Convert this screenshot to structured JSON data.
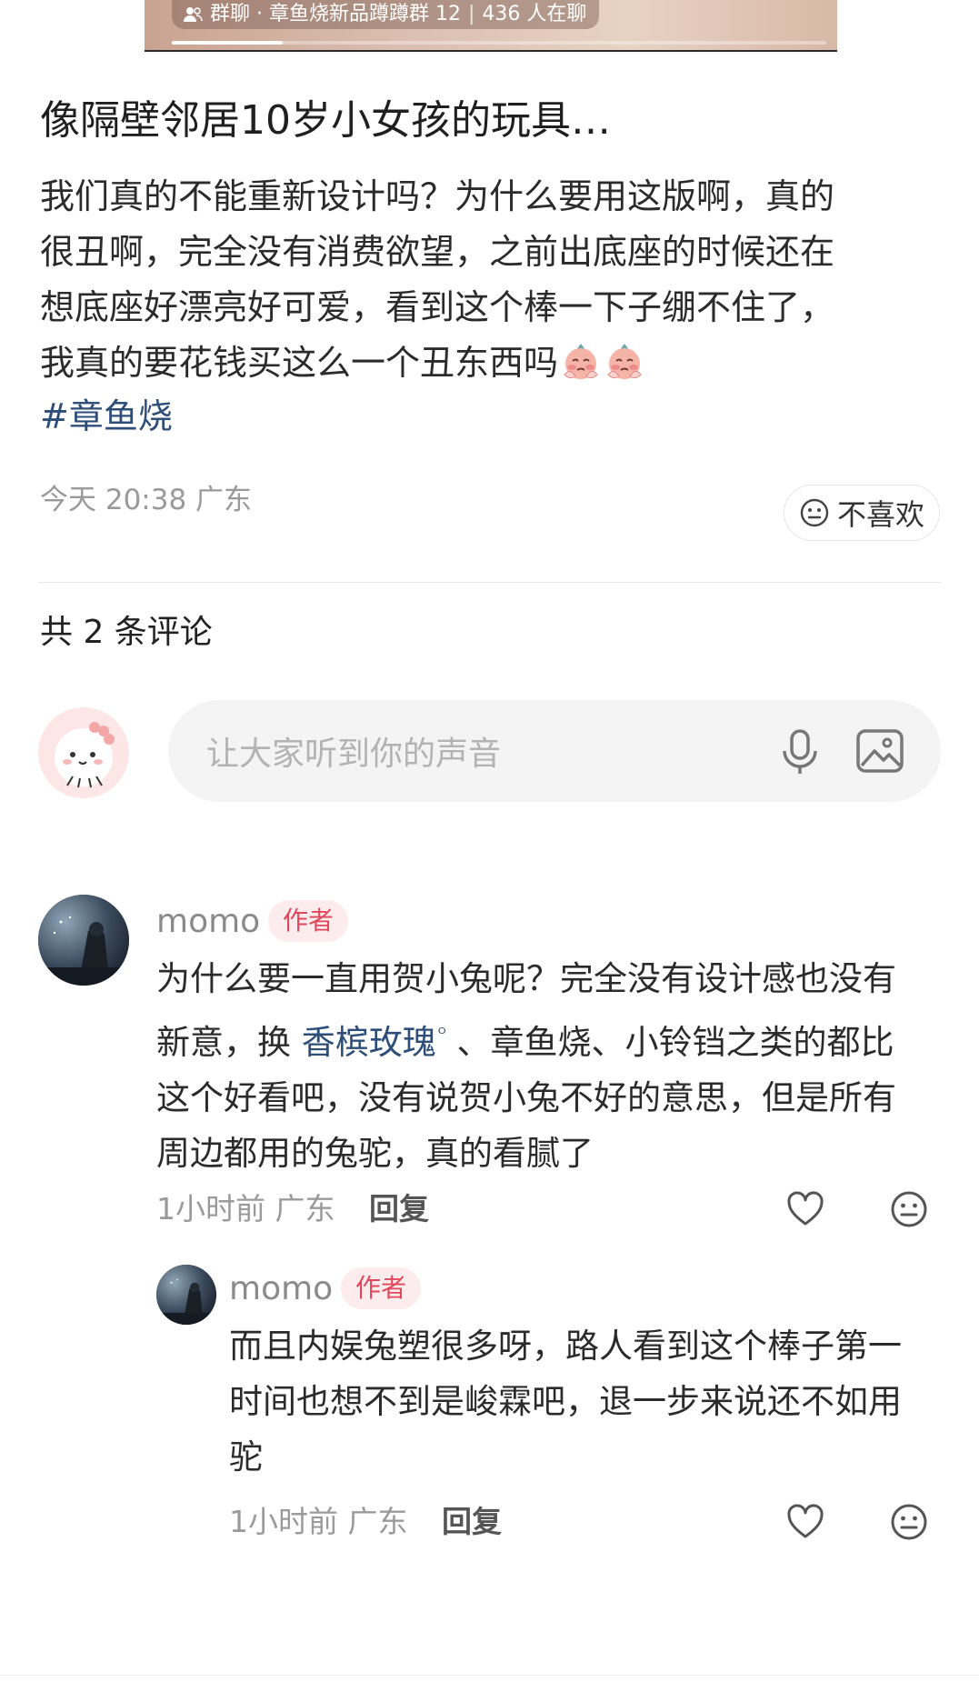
{
  "banner": {
    "group_label": "群聊 · 章鱼烧新品蹲蹲群 12",
    "chatting_count": "436 人在聊",
    "progress": 0.17
  },
  "post": {
    "title": "像隔壁邻居10岁小女孩的玩具…",
    "body_lines": [
      "我们真的不能重新设计吗？为什么要用这版啊，真的",
      "很丑啊，完全没有消费欲望，之前出底座的时候还在",
      "想底座好漂亮好可爱，看到这个棒一下子绷不住了，",
      "我真的要花钱买这么一个丑东西吗"
    ],
    "hashtag": "#章鱼烧",
    "meta": "今天 20:38 广东",
    "dislike_label": "不喜欢"
  },
  "comments_header": "共 2 条评论",
  "comment_input": {
    "placeholder": "让大家听到你的声音"
  },
  "comments": [
    {
      "username": "momo",
      "badge": "作者",
      "text_segments": {
        "line1": "为什么要一直用贺小兔呢？完全没有设计感也没有",
        "line2_before": "新意，换 ",
        "line2_link": "香槟玫瑰",
        "line2_after": " 、章鱼烧、小铃铛之类的都比",
        "line3": "这个好看吧，没有说贺小兔不好的意思，但是所有",
        "line4": "周边都用的兔驼，真的看腻了"
      },
      "meta": "1小时前 广东",
      "reply_label": "回复"
    },
    {
      "username": "momo",
      "badge": "作者",
      "lines": [
        "而且内娱兔塑很多呀，路人看到这个棒子第一",
        "时间也想不到是峻霖吧，退一步来说还不如用",
        "驼"
      ],
      "meta": "1小时前 广东",
      "reply_label": "回复"
    }
  ],
  "colors": {
    "link": "#2e4e7a",
    "badge_text": "#e0475b",
    "badge_bg": "#fdecee",
    "meta": "#9a9a9a"
  },
  "icons": {
    "banner": "group-chat-icon",
    "dislike": "neutral-face-icon",
    "input": [
      "microphone-icon",
      "image-icon"
    ],
    "actions": [
      "heart-icon",
      "neutral-face-icon"
    ]
  }
}
